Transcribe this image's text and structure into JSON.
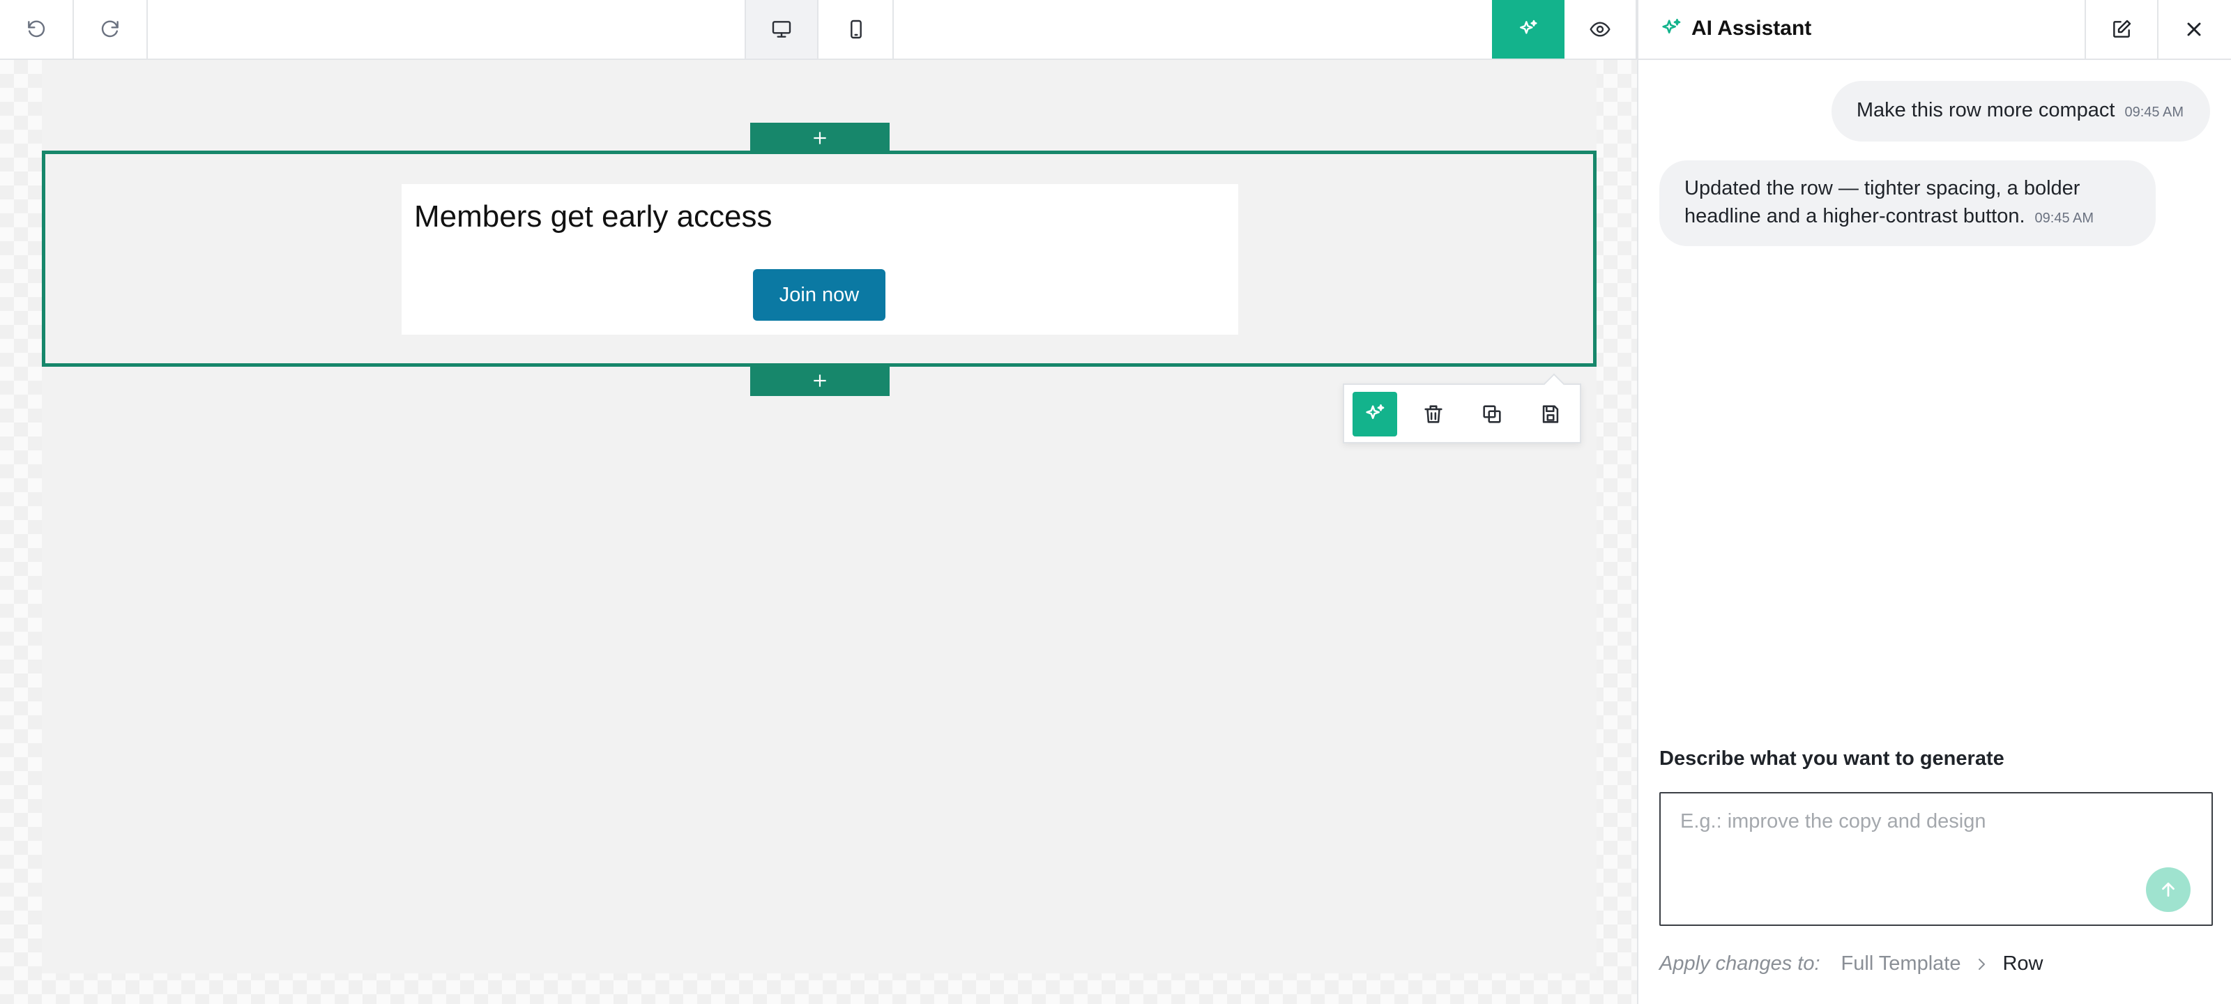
{
  "colors": {
    "accent": "#13b38c",
    "row_selection": "#17876b",
    "button": "#0b79a3"
  },
  "toolbar": {
    "undo_icon": "undo-icon",
    "redo_icon": "redo-icon",
    "desktop_icon": "desktop-icon",
    "mobile_icon": "mobile-icon",
    "ai_icon": "sparkles-icon",
    "preview_icon": "eye-icon"
  },
  "canvas": {
    "row": {
      "headline": "Members get early access",
      "button_label": "Join now"
    },
    "row_actions": [
      "sparkles-icon",
      "trash-icon",
      "duplicate-icon",
      "save-icon"
    ]
  },
  "ai_panel": {
    "title": "AI Assistant",
    "messages": [
      {
        "role": "user",
        "text": "Make this row more compact",
        "time": "09:45 AM"
      },
      {
        "role": "assistant",
        "text": "Updated the row — tighter spacing, a bolder headline and a higher-contrast button.",
        "time": "09:45 AM"
      }
    ],
    "prompt_label": "Describe what you want to generate",
    "prompt_placeholder": "E.g.: improve the copy and design",
    "apply_label": "Apply changes to:",
    "scopes": [
      "Full Template",
      "Row"
    ],
    "selected_scope": "Row"
  }
}
